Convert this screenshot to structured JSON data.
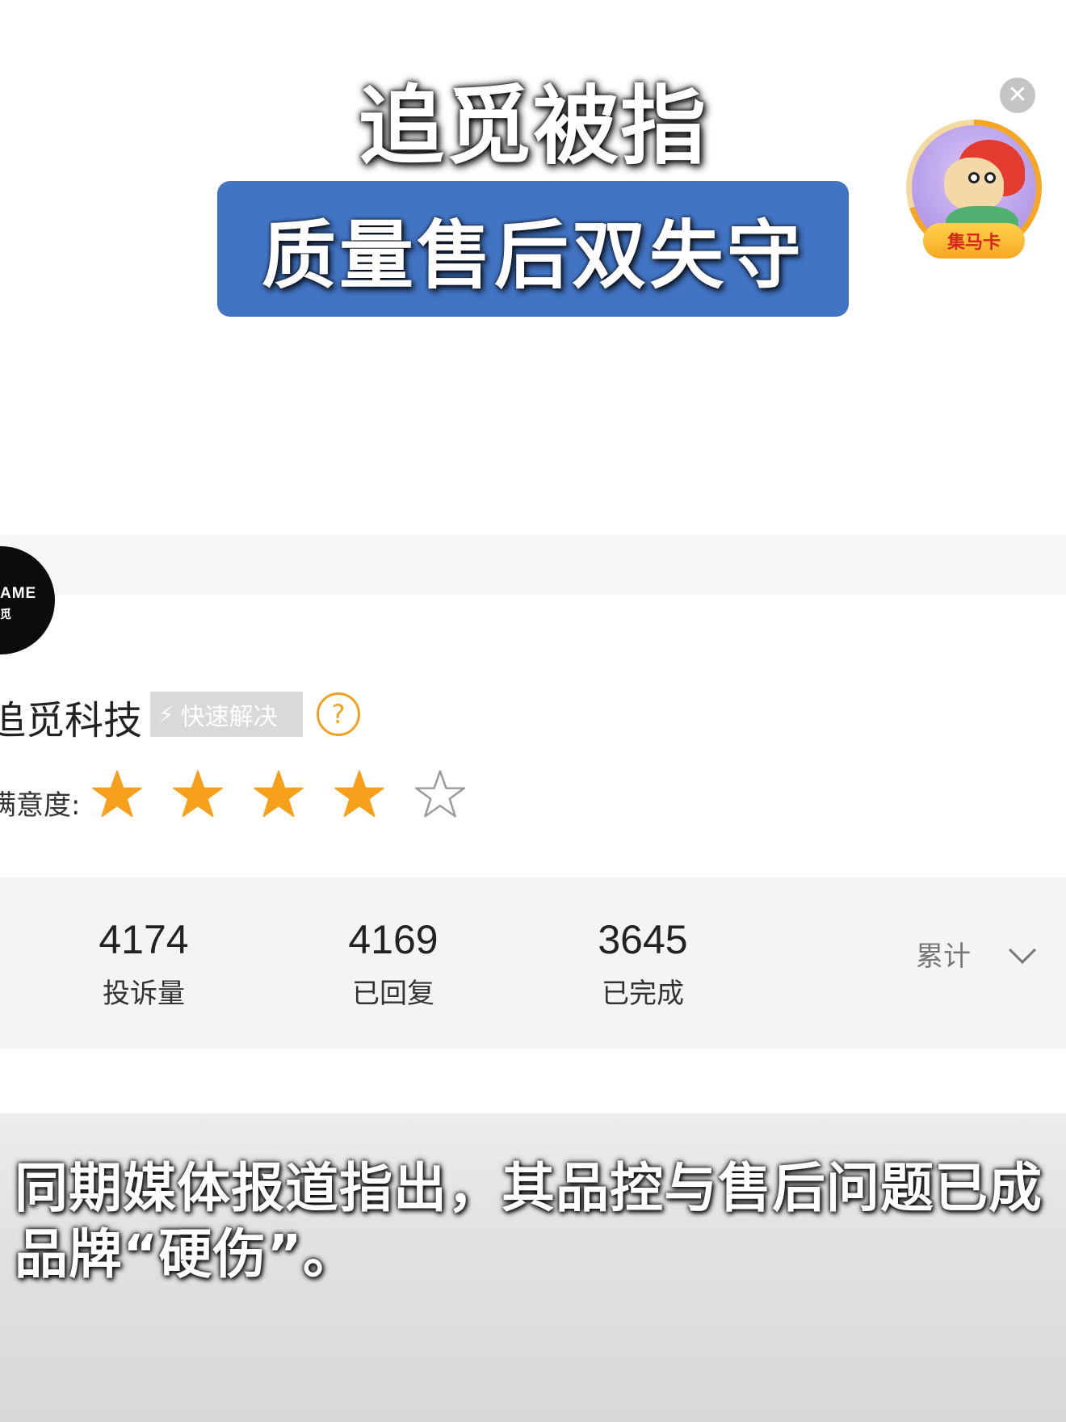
{
  "headline": {
    "title": "追觅被指",
    "banner": "质量售后双失守"
  },
  "badge": {
    "label": "集马卡",
    "close_icon": "close-icon",
    "ring_color": "#f6a623"
  },
  "company": {
    "logo_text": "AME",
    "logo_subtext": "觅",
    "name": "追觅科技",
    "quick_tag": "快速解决",
    "help_icon": "question-icon",
    "satisfaction_label": "满意度:",
    "rating": 4,
    "rating_max": 5,
    "star_color": "#f7a01c"
  },
  "stats": {
    "items": [
      {
        "value": "4174",
        "label": "投诉量"
      },
      {
        "value": "4169",
        "label": "已回复"
      },
      {
        "value": "3645",
        "label": "已完成"
      }
    ],
    "period": "累计"
  },
  "subtitle": "同期媒体报道指出，其品控与售后问题已成品牌“硬伤”。",
  "colors": {
    "banner_bg": "#4274c4",
    "help_accent": "#f0a21f"
  }
}
